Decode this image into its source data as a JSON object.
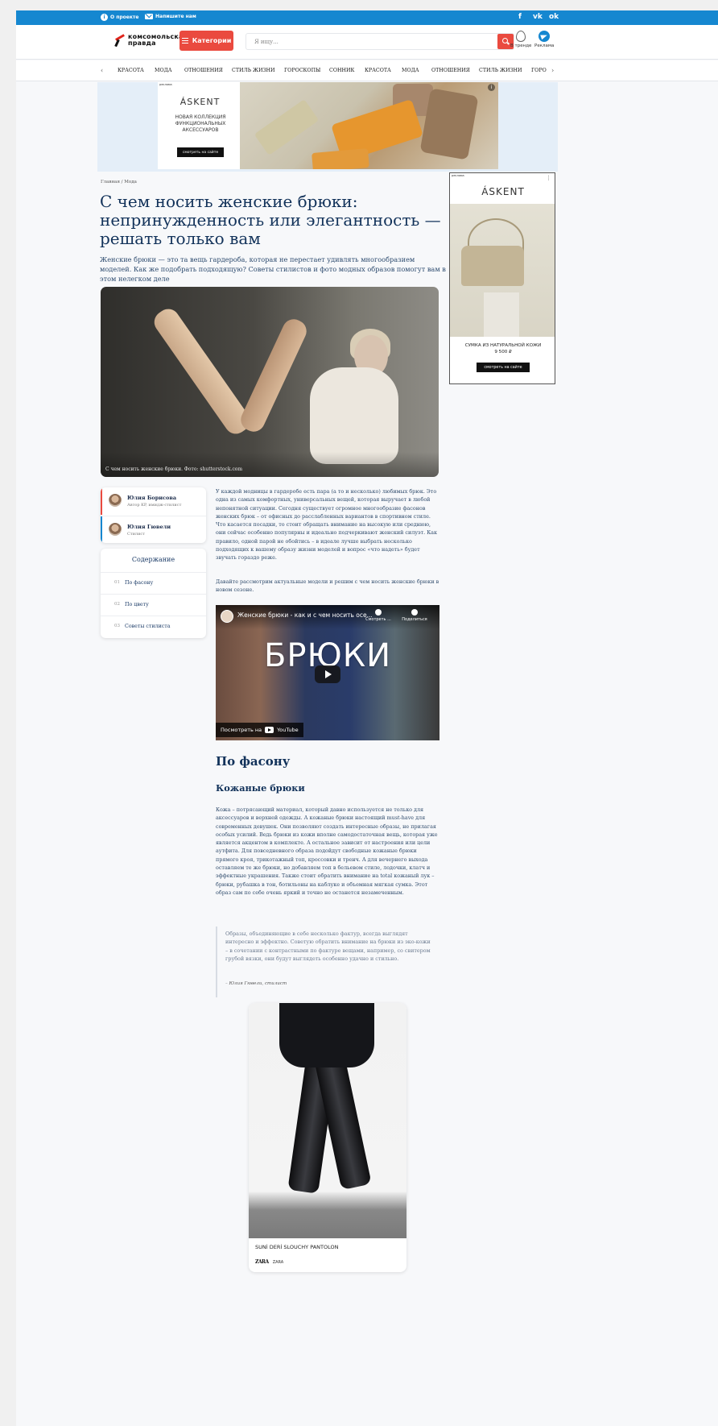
{
  "topbar": {
    "about_label": "О проекте",
    "write_label": "Напишите нам",
    "social": [
      "f",
      "vk",
      "ok"
    ]
  },
  "header": {
    "logo_line1": "комсомольская",
    "logo_line2": "правда",
    "categories_label": "Категории",
    "search_placeholder": "Я ищу...",
    "trend_label": "В тренде",
    "ads_label": "Реклама"
  },
  "nav": {
    "items": [
      "Красота",
      "Мода",
      "Отношения",
      "Стиль жизни",
      "Гороскопы",
      "Сонник",
      "Красота",
      "Мода",
      "Отношения",
      "Стиль жизни",
      "Горо"
    ]
  },
  "top_ad": {
    "label": "реклама",
    "brand": "ÁSKENT",
    "text": "Новая коллекция функциональных аксессуаров",
    "cta": "смотреть на сайте"
  },
  "side_ad": {
    "label": "реклама",
    "brand": "ÁSKENT",
    "text": "Сумка из натуральной кожи",
    "price": "9 500 ₽",
    "cta": "смотреть на сайте"
  },
  "article": {
    "breadcrumb": "Главная / Мода",
    "title": "С чем носить женские брюки: непринужденность или элегантность — решать только вам",
    "lead": "Женские брюки — это та вещь гардероба, которая не перестает удивлять многообразием моделей. Как же подобрать подходящую? Советы стилистов и фото модных образов помогут вам в этом нелегком деле",
    "hero_caption": "С чем носить женские брюки. Фото: shutterstock.com",
    "paragraph1": "У каждой модницы в гардеробе есть пара (а то и несколько) любимых брюк. Это одна из самых комфортных, универсальных вещей, которая выручает в любой непонятной ситуации. Сегодня существует огромное многообразие фасонов женских брюк – от офисных до расслабленных вариантов в спортивном стиле. Что касается посадки, то стоит обращать внимание на высокую или среднюю, они сейчас особенно популярны и идеально подчеркивают женский силуэт. Как правило, одной парой не обойтись – в идеале лучше выбрать несколько подходящих к вашему образу жизни моделей и вопрос «что надеть» будет звучать гораздо реже.",
    "paragraph2": "Давайте рассмотрим актуальные модели и решим с чем носить женские брюки в новом сезоне.",
    "h2": "По фасону",
    "h3": "Кожаные брюки",
    "paragraph3": "Кожа – потрясающий материал, который давно используется не только для аксессуаров и верхней одежды. А кожаные брюки настоящий must-have для современных девушек. Они позволяют создать интересные образы, не прилагая особых усилий. Ведь брюки из кожи вполне самодостаточная вещь, которая уже является акцентом в комплекте. А остальное зависит от настроения или цели аутфита. Для повседневного образа подойдут свободные кожаные брюки прямого кроя, трикотажный топ, кроссовки и тренч. А для вечернего выхода оставляем те же брюки, но добавляем топ в бельевом стиле, лодочки, клатч и эффектные украшения. Также стоит обратить внимание на total кожаный лук – брюки, рубашка в тон, ботильоны на каблуке и объемная мягкая сумка. Этот образ сам по себе очень яркий и точно не останется незамеченным.",
    "quote": "Образы, объединяющие в себе несколько фактур, всегда выглядят интересно и эффектно. Советую обратить внимание на брюки из эко-кожи – в сочетании с контрастными по фактуре вещами, например, со свитером грубой вязки, они будут выглядеть особенно удачно и стильно.",
    "quote_author": "– Юлия Гювели, стилист"
  },
  "authors": [
    {
      "name": "Юлия Борисова",
      "role": "Автор KP, имидж-стилист",
      "accent": "#ea4a3f"
    },
    {
      "name": "Юлия Гювели",
      "role": "Стилист",
      "accent": "#1587d0"
    }
  ],
  "toc": {
    "title": "Содержание",
    "items": [
      {
        "num": "01",
        "label": "По фасону"
      },
      {
        "num": "02",
        "label": "По цвету"
      },
      {
        "num": "03",
        "label": "Советы стилиста"
      }
    ]
  },
  "video": {
    "title": "Женские брюки - как и с чем носить осе...",
    "watch_later": "Смотреть ...",
    "share": "Поделиться",
    "big_text": "БРЮКИ",
    "watch_on": "Посмотреть на",
    "yt_label": "YouTube"
  },
  "product": {
    "name": "SUNİ DERİ SLOUCHY PANTOLON",
    "shop_logo": "ZARA",
    "shop": "ZARA"
  },
  "colors": {
    "topbar": "#1587d0",
    "accent_red": "#ea4a3f",
    "title": "#12325a"
  }
}
